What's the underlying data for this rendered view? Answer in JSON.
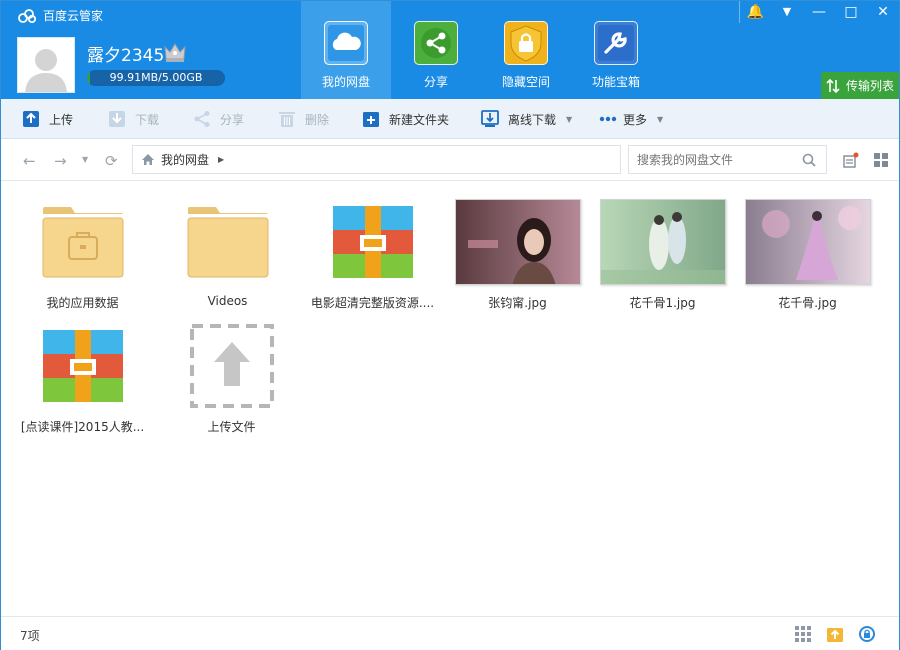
{
  "app": {
    "title": "百度云管家"
  },
  "user": {
    "name": "露夕2345",
    "quota_text": "99.91MB/5.00GB",
    "quota_fraction": 0.02
  },
  "nav": {
    "tabs": [
      {
        "label": "我的网盘",
        "icon": "cloud-icon",
        "active": true
      },
      {
        "label": "分享",
        "icon": "share-icon"
      },
      {
        "label": "隐藏空间",
        "icon": "lock-icon"
      },
      {
        "label": "功能宝箱",
        "icon": "wrench-icon"
      }
    ]
  },
  "window": {
    "bell": "🔔",
    "menu": "▼",
    "minimize": "—",
    "maximize": "□",
    "close": "✕"
  },
  "transfer": {
    "label": "传输列表"
  },
  "toolbar": {
    "upload": "上传",
    "download": "下载",
    "share": "分享",
    "delete": "删除",
    "new_folder": "新建文件夹",
    "offline_download": "离线下载",
    "more": "更多"
  },
  "address": {
    "path": "我的网盘",
    "search_placeholder": "搜索我的网盘文件"
  },
  "files": [
    {
      "name": "我的应用数据",
      "type": "app-folder"
    },
    {
      "name": "Videos",
      "type": "folder"
    },
    {
      "name": "电影超清完整版资源....",
      "type": "archive"
    },
    {
      "name": "张钧甯.jpg",
      "type": "image"
    },
    {
      "name": "花千骨1.jpg",
      "type": "image"
    },
    {
      "name": "花千骨.jpg",
      "type": "image"
    },
    {
      "name": "[点读课件]2015人教...",
      "type": "archive"
    },
    {
      "name": "上传文件",
      "type": "upload-placeholder"
    }
  ],
  "status": {
    "count": "7项"
  },
  "colors": {
    "header": "#1a8be4",
    "active_tab": "#3c9fe9",
    "transfer": "#3aa33c",
    "toolbar": "#ebf2f9"
  }
}
